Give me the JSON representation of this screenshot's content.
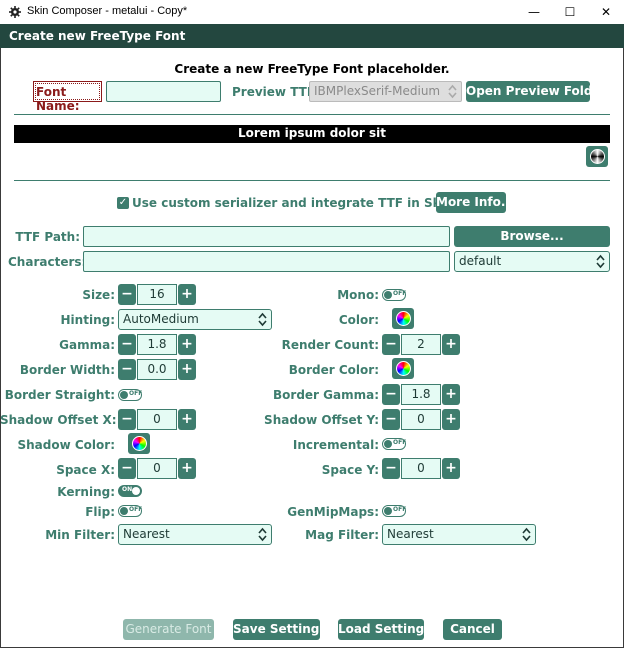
{
  "window": {
    "title": "Skin Composer - metalui - Copy*",
    "minimize_glyph": "—",
    "maximize_glyph": "☐",
    "close_glyph": "✕"
  },
  "dialog": {
    "title": "Create new FreeType Font",
    "heading": "Create a new FreeType Font placeholder."
  },
  "font_name": {
    "label": "Font Name:",
    "value": ""
  },
  "preview_ttf": {
    "label": "Preview TTF:",
    "value": "IBMPlexSerif-Medium",
    "open_folder_label": "Open Preview Folder"
  },
  "preview_text": "Lorem ipsum dolor sit",
  "preview_color_icon": "bw-color-wheel-icon",
  "serializer": {
    "checked": true,
    "check_glyph": "✓",
    "label": "Use custom serializer and integrate TTF in Skin JSON",
    "more_info_label": "More Info..."
  },
  "ttf_path": {
    "label": "TTF Path:",
    "value": "",
    "browse_label": "Browse..."
  },
  "characters": {
    "label": "Characters:",
    "value": "",
    "preset": "default"
  },
  "settings_left": {
    "size": {
      "label": "Size:",
      "value": "16"
    },
    "hinting": {
      "label": "Hinting:",
      "value": "AutoMedium"
    },
    "gamma": {
      "label": "Gamma:",
      "value": "1.8"
    },
    "border_width": {
      "label": "Border Width:",
      "value": "0.0"
    },
    "border_straight": {
      "label": "Border Straight:",
      "state": "OFF"
    },
    "shadow_offset_x": {
      "label": "Shadow Offset X:",
      "value": "0"
    },
    "shadow_color": {
      "label": "Shadow Color:"
    },
    "space_x": {
      "label": "Space X:",
      "value": "0"
    },
    "kerning": {
      "label": "Kerning:",
      "state": "ON"
    },
    "flip": {
      "label": "Flip:",
      "state": "OFF"
    },
    "min_filter": {
      "label": "Min Filter:",
      "value": "Nearest"
    }
  },
  "settings_right": {
    "mono": {
      "label": "Mono:",
      "state": "OFF"
    },
    "color": {
      "label": "Color:"
    },
    "render_count": {
      "label": "Render Count:",
      "value": "2"
    },
    "border_color": {
      "label": "Border Color:"
    },
    "border_gamma": {
      "label": "Border Gamma:",
      "value": "1.8"
    },
    "shadow_offset_y": {
      "label": "Shadow Offset Y:",
      "value": "0"
    },
    "incremental": {
      "label": "Incremental:",
      "state": "OFF"
    },
    "space_y": {
      "label": "Space Y:",
      "value": "0"
    },
    "gen_mip_maps": {
      "label": "GenMipMaps:",
      "state": "OFF"
    },
    "mag_filter": {
      "label": "Mag Filter:",
      "value": "Nearest"
    }
  },
  "spinner": {
    "minus": "−",
    "plus": "+"
  },
  "footer": {
    "generate_label": "Generate Font",
    "save_label": "Save Settings",
    "load_label": "Load Settings",
    "cancel_label": "Cancel"
  },
  "colors": {
    "accent": "#3e7d6e",
    "header": "#23473f",
    "field_bg": "#e5fbf4",
    "error": "#8b1a1a"
  }
}
